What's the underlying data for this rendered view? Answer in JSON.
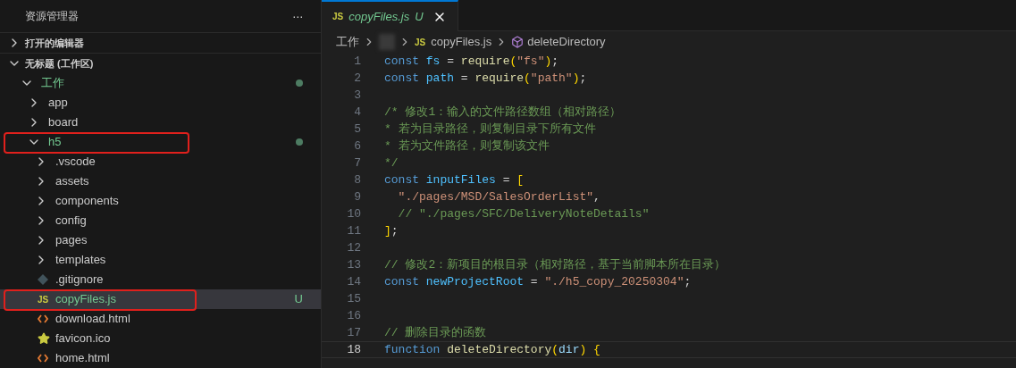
{
  "sidebar": {
    "title": "资源管理器",
    "more": "···",
    "sections": [
      {
        "label": "打开的编辑器",
        "expanded": false
      },
      {
        "label": "无标题 (工作区)",
        "expanded": true,
        "tree": [
          {
            "label": "工作",
            "kind": "folder",
            "expanded": true,
            "modified": true,
            "selected": false,
            "highlighted": false,
            "children": [
              {
                "label": "app",
                "kind": "folder",
                "expanded": false,
                "modified": false,
                "selected": false,
                "highlighted": false
              },
              {
                "label": "board",
                "kind": "folder",
                "expanded": false,
                "modified": false,
                "selected": false,
                "highlighted": false
              },
              {
                "label": "h5",
                "kind": "folder",
                "expanded": true,
                "modified": true,
                "selected": false,
                "highlighted": true,
                "children": [
                  {
                    "label": ".vscode",
                    "kind": "folder",
                    "expanded": false,
                    "modified": false,
                    "selected": false,
                    "highlighted": false
                  },
                  {
                    "label": "assets",
                    "kind": "folder",
                    "expanded": false,
                    "modified": false,
                    "selected": false,
                    "highlighted": false
                  },
                  {
                    "label": "components",
                    "kind": "folder",
                    "expanded": false,
                    "modified": false,
                    "selected": false,
                    "highlighted": false
                  },
                  {
                    "label": "config",
                    "kind": "folder",
                    "expanded": false,
                    "modified": false,
                    "selected": false,
                    "highlighted": false
                  },
                  {
                    "label": "pages",
                    "kind": "folder",
                    "expanded": false,
                    "modified": false,
                    "selected": false,
                    "highlighted": false
                  },
                  {
                    "label": "templates",
                    "kind": "folder",
                    "expanded": false,
                    "modified": false,
                    "selected": false,
                    "highlighted": false
                  },
                  {
                    "label": ".gitignore",
                    "kind": "ignore",
                    "modified": false,
                    "selected": false,
                    "highlighted": false
                  },
                  {
                    "label": "copyFiles.js",
                    "kind": "script",
                    "icon_text": "JS",
                    "git_status": "U",
                    "modified": true,
                    "selected": true,
                    "highlighted": true
                  },
                  {
                    "label": "download.html",
                    "kind": "markup",
                    "modified": false,
                    "selected": false,
                    "highlighted": false
                  },
                  {
                    "label": "favicon.ico",
                    "kind": "image",
                    "modified": false,
                    "selected": false,
                    "highlighted": false
                  },
                  {
                    "label": "home.html",
                    "kind": "markup",
                    "modified": false,
                    "selected": false,
                    "highlighted": false
                  }
                ]
              }
            ]
          }
        ]
      }
    ]
  },
  "tabs": [
    {
      "icon_text": "JS",
      "label": "copyFiles.js",
      "status": "U",
      "selected": true
    }
  ],
  "breadcrumb": {
    "items": [
      {
        "kind": "text",
        "label": "工作"
      },
      {
        "kind": "hidden"
      },
      {
        "kind": "file",
        "icon_text": "JS",
        "label": "copyFiles.js"
      },
      {
        "kind": "symbol",
        "label": "deleteDirectory"
      }
    ]
  },
  "editor": {
    "lines": [
      {
        "number": "1",
        "current": false,
        "tokens": [
          {
            "t": "const ",
            "kind": "kw"
          },
          {
            "t": "fs",
            "kind": "var"
          },
          {
            "t": " = ",
            "kind": "op"
          },
          {
            "t": "require",
            "kind": "fn"
          },
          {
            "t": "(",
            "kind": "br"
          },
          {
            "t": "\"fs\"",
            "kind": "str"
          },
          {
            "t": ")",
            "kind": "br"
          },
          {
            "t": ";",
            "kind": "op"
          }
        ]
      },
      {
        "number": "2",
        "current": false,
        "tokens": [
          {
            "t": "const ",
            "kind": "kw"
          },
          {
            "t": "path",
            "kind": "var"
          },
          {
            "t": " = ",
            "kind": "op"
          },
          {
            "t": "require",
            "kind": "fn"
          },
          {
            "t": "(",
            "kind": "br"
          },
          {
            "t": "\"path\"",
            "kind": "str"
          },
          {
            "t": ")",
            "kind": "br"
          },
          {
            "t": ";",
            "kind": "op"
          }
        ]
      },
      {
        "number": "3",
        "current": false
      },
      {
        "number": "4",
        "current": false,
        "tokens": [
          {
            "t": "/* 修改1：输入的文件路径数组（相对路径）",
            "kind": "cm"
          }
        ]
      },
      {
        "number": "5",
        "current": false,
        "tokens": [
          {
            "t": "* 若为目录路径，则复制目录下所有文件",
            "kind": "cm"
          }
        ]
      },
      {
        "number": "6",
        "current": false,
        "tokens": [
          {
            "t": "* 若为文件路径，则复制该文件",
            "kind": "cm"
          }
        ]
      },
      {
        "number": "7",
        "current": false,
        "tokens": [
          {
            "t": "*/",
            "kind": "cm"
          }
        ]
      },
      {
        "number": "8",
        "current": false,
        "tokens": [
          {
            "t": "const ",
            "kind": "kw"
          },
          {
            "t": "inputFiles",
            "kind": "var"
          },
          {
            "t": " = ",
            "kind": "op"
          },
          {
            "t": "[",
            "kind": "br"
          }
        ]
      },
      {
        "number": "9",
        "current": false,
        "tokens": [
          {
            "t": "  \"./pages/MSD/SalesOrderList\"",
            "kind": "str"
          },
          {
            "t": ",",
            "kind": "op"
          }
        ]
      },
      {
        "number": "10",
        "current": false,
        "tokens": [
          {
            "t": "  // \"./pages/SFC/DeliveryNoteDetails\"",
            "kind": "cm"
          }
        ]
      },
      {
        "number": "11",
        "current": false,
        "tokens": [
          {
            "t": "]",
            "kind": "br"
          },
          {
            "t": ";",
            "kind": "op"
          }
        ]
      },
      {
        "number": "12",
        "current": false
      },
      {
        "number": "13",
        "current": false,
        "tokens": [
          {
            "t": "// 修改2：新项目的根目录（相对路径，基于当前脚本所在目录）",
            "kind": "cm"
          }
        ]
      },
      {
        "number": "14",
        "current": false,
        "tokens": [
          {
            "t": "const ",
            "kind": "kw"
          },
          {
            "t": "newProjectRoot",
            "kind": "var"
          },
          {
            "t": " = ",
            "kind": "op"
          },
          {
            "t": "\"./h5_copy_20250304\"",
            "kind": "str"
          },
          {
            "t": ";",
            "kind": "op"
          }
        ]
      },
      {
        "number": "15",
        "current": false
      },
      {
        "number": "16",
        "current": false
      },
      {
        "number": "17",
        "current": false,
        "tokens": [
          {
            "t": "// 删除目录的函数",
            "kind": "cm"
          }
        ]
      },
      {
        "number": "18",
        "current": true,
        "tokens": [
          {
            "t": "function ",
            "kind": "kw"
          },
          {
            "t": "deleteDirectory",
            "kind": "fn"
          },
          {
            "t": "(",
            "kind": "br"
          },
          {
            "t": "dir",
            "kind": "param"
          },
          {
            "t": ") ",
            "kind": "br"
          },
          {
            "t": "{",
            "kind": "br"
          }
        ]
      }
    ]
  }
}
